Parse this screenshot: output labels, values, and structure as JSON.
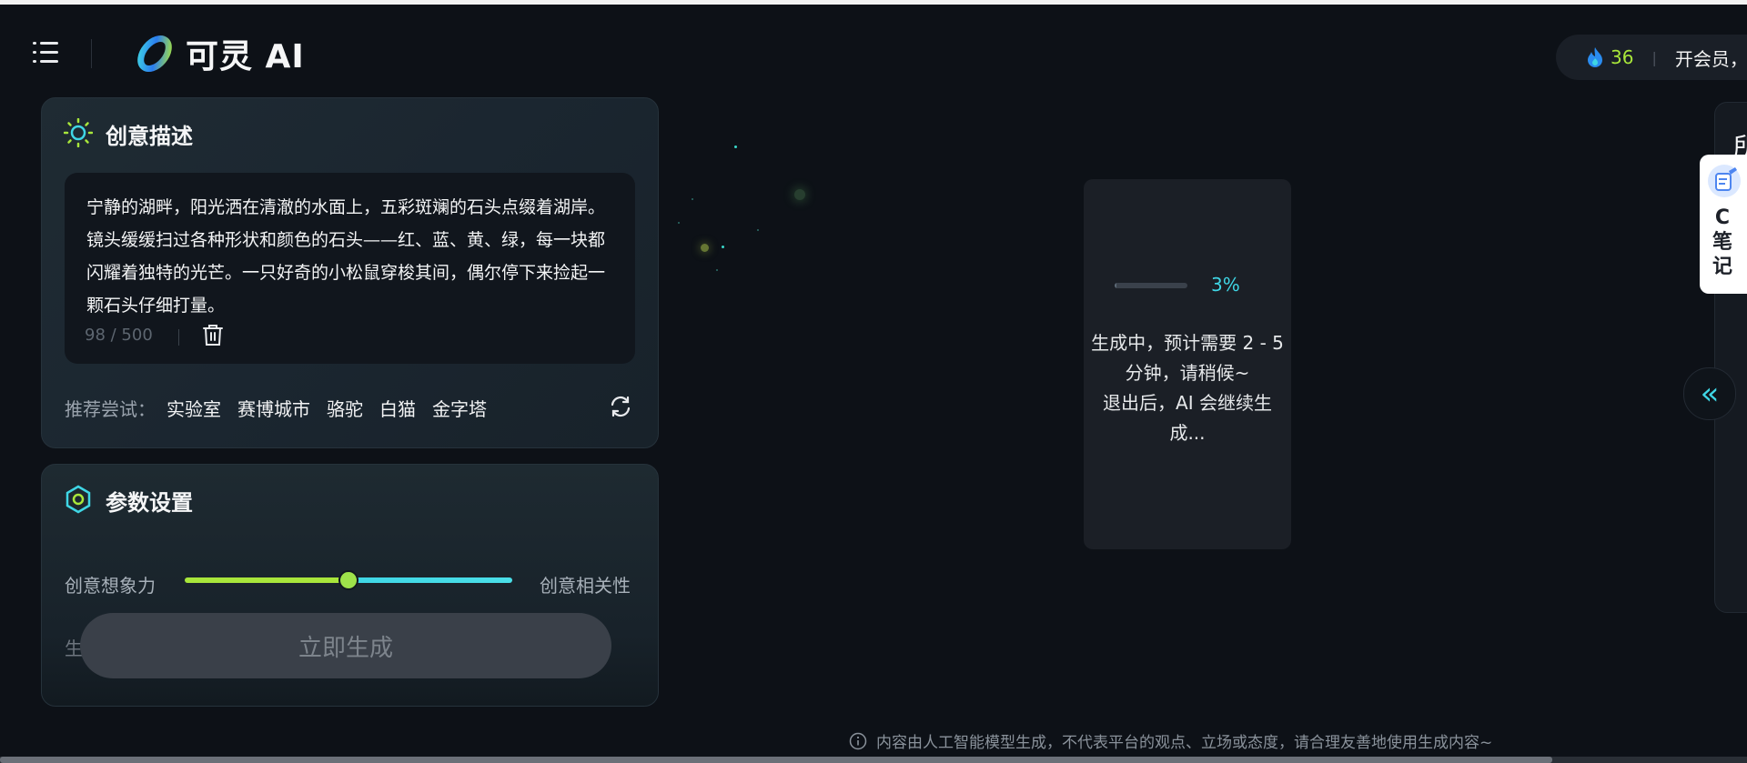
{
  "header": {
    "brand_text": "可灵 AI",
    "credits": "36",
    "pill_label": "开会员，得"
  },
  "creative": {
    "title": "创意描述",
    "prompt": "宁静的湖畔，阳光洒在清澈的水面上，五彩斑斓的石头点缀着湖岸。镜头缓缓扫过各种形状和颜色的石头——红、蓝、黄、绿，每一块都闪耀着独特的光芒。一只好奇的小松鼠穿梭其间，偶尔停下来捡起一颗石头仔细打量。",
    "char_count": "98 / 500",
    "recommend_label": "推荐尝试：",
    "recommend_tags": [
      "实验室",
      "赛博城市",
      "骆驼",
      "白猫",
      "金字塔"
    ]
  },
  "params": {
    "title": "参数设置",
    "slider_left": "创意想象力",
    "slider_right": "创意相关性",
    "slider_value": 0.5,
    "cut_label": "生"
  },
  "generate_button": "立即生成",
  "progress": {
    "percent": "3%",
    "percent_value": 0.03,
    "message": "生成中，预计需要 2 - 5\n分钟，请稍候~\n退出后，AI 会继续生\n成..."
  },
  "right_panel": {
    "partial_title": "所",
    "collapse_icon": "double-chevron-left-icon"
  },
  "notes": {
    "label": "C\n笔\n记"
  },
  "footer": {
    "disclaimer": "内容由人工智能模型生成，不代表平台的观点、立场或态度，请合理友善地使用生成内容~"
  },
  "colors": {
    "accent_cyan": "#3fd6e5",
    "accent_green": "#a8e63b",
    "background": "#0d1117"
  }
}
